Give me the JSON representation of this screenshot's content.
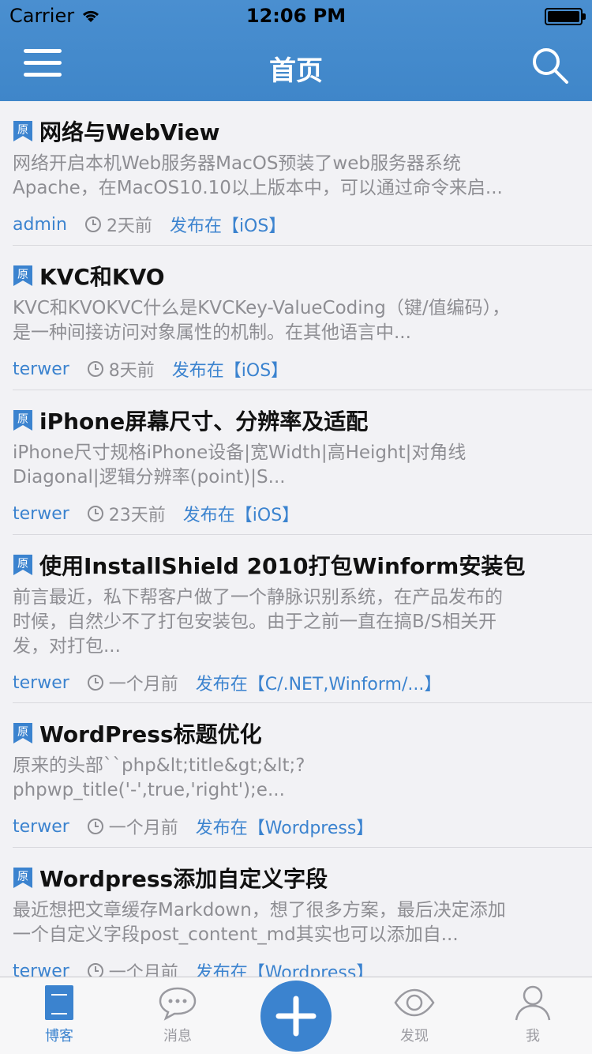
{
  "status_bar": {
    "carrier": "Carrier",
    "time": "12:06 PM"
  },
  "nav": {
    "title": "首页"
  },
  "articles": [
    {
      "title": "网络与WebView",
      "summary_line1": "网络开启本机Web服务器MacOS预装了web服务器系统",
      "summary_line2": "Apache，在MacOS10.10以上版本中，可以通过命令来启...",
      "summary_line3": "",
      "author": "admin",
      "age": "2天前",
      "published": "发布在【iOS】"
    },
    {
      "title": "KVC和KVO",
      "summary_line1": "KVC和KVOKVC什么是KVCKey-ValueCoding（键/值编码），",
      "summary_line2": "是一种间接访问对象属性的机制。在其他语言中...",
      "summary_line3": "",
      "author": "terwer",
      "age": "8天前",
      "published": "发布在【iOS】"
    },
    {
      "title": "iPhone屏幕尺寸、分辨率及适配",
      "summary_line1": "iPhone尺寸规格iPhone设备|宽Width|高Height|对角线",
      "summary_line2": "Diagonal|逻辑分辨率(point)|S...",
      "summary_line3": "",
      "author": "terwer",
      "age": "23天前",
      "published": "发布在【iOS】"
    },
    {
      "title": "使用InstallShield 2010打包Winform安装包",
      "summary_line1": "前言最近，私下帮客户做了一个静脉识别系统，在产品发布的",
      "summary_line2": "时候，自然少不了打包安装包。由于之前一直在搞B/S相关开",
      "summary_line3": "发，对打包...",
      "author": "terwer",
      "age": "一个月前",
      "published": "发布在【C/.NET,Winform/...】"
    },
    {
      "title": "WordPress标题优化",
      "summary_line1": "原来的头部``php&lt;title&gt;&lt;?",
      "summary_line2": "phpwp_title('-',true,'right');e...",
      "summary_line3": "",
      "author": "terwer",
      "age": "一个月前",
      "published": "发布在【Wordpress】"
    },
    {
      "title": "Wordpress添加自定义字段",
      "summary_line1": "最近想把文章缓存Markdown，想了很多方案，最后决定添加",
      "summary_line2": "一个自定义字段post_content_md其实也可以添加自...",
      "summary_line3": "",
      "author": "terwer",
      "age": "一个月前",
      "published": "发布在【Wordpress】"
    }
  ],
  "tabbar": {
    "blog": "博客",
    "messages": "消息",
    "discover": "发现",
    "me": "我"
  },
  "colors": {
    "accent": "#3b83cf",
    "nav_bg": "#4289cc",
    "muted_text": "#8e8e93"
  },
  "icons": {
    "menu": "hamburger-icon",
    "search": "search-icon",
    "original_tag": "original-tag-icon",
    "clock": "clock-icon",
    "blog": "document-icon",
    "messages": "chat-bubble-icon",
    "add": "plus-icon",
    "discover": "eye-icon",
    "me": "person-icon"
  }
}
